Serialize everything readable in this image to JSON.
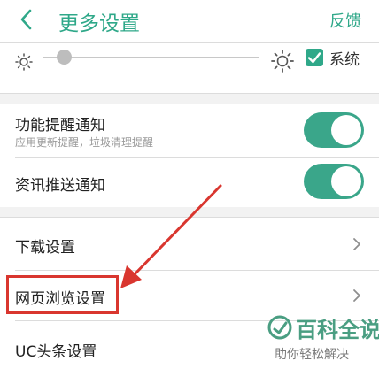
{
  "header": {
    "title": "更多设置",
    "feedback_label": "反馈"
  },
  "brightness": {
    "system_label": "系统",
    "system_checked": true,
    "slider_level_fraction": 0.1
  },
  "notifications": {
    "feature_reminder": {
      "title": "功能提醒通知",
      "subtitle": "应用更新提醒，垃圾清理提醒",
      "enabled": true
    },
    "news_push": {
      "title": "资讯推送通知",
      "enabled": true
    }
  },
  "menu": {
    "download_settings": "下载设置",
    "web_browse_settings": "网页浏览设置",
    "uc_headline_settings": "UC头条设置"
  },
  "watermark": {
    "name": "百科全说",
    "slogan": "助你轻松解决"
  },
  "colors": {
    "accent": "#2fa889",
    "toggle_on": "#3aa68a",
    "annotation": "#d9362f"
  }
}
